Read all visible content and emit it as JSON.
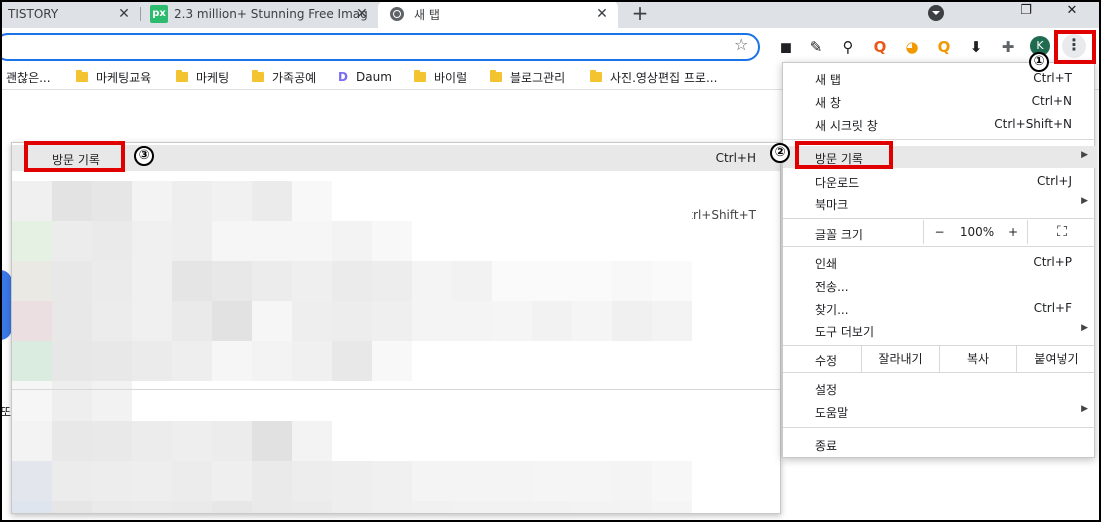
{
  "tabs": [
    {
      "title": "TISTORY",
      "close": "✕"
    },
    {
      "icon_text": "px",
      "title": "2.3 million+ Stunning Free Imag",
      "close": "✕"
    },
    {
      "title": "새 탭",
      "close": "✕"
    }
  ],
  "new_tab": "+",
  "window_controls": {
    "restore": "❐",
    "close": "✕"
  },
  "toolbar": {
    "star": "☆",
    "avatar": "K",
    "menu": "⋮"
  },
  "extensions": [
    {
      "name": "ext-glasses",
      "glyph": "◼",
      "color": "#202124"
    },
    {
      "name": "ext-pen",
      "glyph": "✎",
      "color": "#202124"
    },
    {
      "name": "ext-magnifier",
      "glyph": "⚲",
      "color": "#202124"
    },
    {
      "name": "ext-q1",
      "glyph": "Q",
      "color": "#e8591a"
    },
    {
      "name": "ext-q2",
      "glyph": "◕",
      "color": "#f29900"
    },
    {
      "name": "ext-q3",
      "glyph": "Q",
      "color": "#f29900"
    },
    {
      "name": "ext-download",
      "glyph": "⬇",
      "color": "#202124"
    },
    {
      "name": "ext-puzzle",
      "glyph": "✚",
      "color": "#5f6368"
    }
  ],
  "bookmarks": [
    {
      "label": "괜찮은...",
      "folder": false,
      "daum": false
    },
    {
      "label": "마케팅교육",
      "folder": true,
      "daum": false
    },
    {
      "label": "마케팅",
      "folder": true,
      "daum": false
    },
    {
      "label": "가족공예",
      "folder": true,
      "daum": false
    },
    {
      "label": "Daum",
      "folder": false,
      "daum": true
    },
    {
      "label": "바이럴",
      "folder": true,
      "daum": false
    },
    {
      "label": "블로그관리",
      "folder": true,
      "daum": false
    },
    {
      "label": "사진.영상편집 프로...",
      "folder": true,
      "daum": false
    }
  ],
  "history_submenu": {
    "title": "방문 기록",
    "shortcut": "Ctrl+H",
    "second_shortcut": "Ctrl+Shift+T"
  },
  "left_fragment": "또",
  "menu": {
    "items_top": [
      {
        "label": "새 탭",
        "shortcut": "Ctrl+T"
      },
      {
        "label": "새 창",
        "shortcut": "Ctrl+N"
      },
      {
        "label": "새 시크릿 창",
        "shortcut": "Ctrl+Shift+N"
      }
    ],
    "items_mid": [
      {
        "label": "방문 기록",
        "shortcut": "",
        "submenu": true
      },
      {
        "label": "다운로드",
        "shortcut": "Ctrl+J",
        "submenu": false
      },
      {
        "label": "북마크",
        "shortcut": "",
        "submenu": true
      }
    ],
    "zoom": {
      "label": "글꼴 크기",
      "minus": "−",
      "value": "100%",
      "plus": "+",
      "fullscreen": "⛶"
    },
    "items_tools": [
      {
        "label": "인쇄",
        "shortcut": "Ctrl+P",
        "submenu": false
      },
      {
        "label": "전송...",
        "shortcut": "",
        "submenu": false
      },
      {
        "label": "찾기...",
        "shortcut": "Ctrl+F",
        "submenu": false
      },
      {
        "label": "도구 더보기",
        "shortcut": "",
        "submenu": true
      }
    ],
    "edit": {
      "label": "수정",
      "cut": "잘라내기",
      "copy": "복사",
      "paste": "붙여넣기"
    },
    "items_settings": [
      {
        "label": "설정",
        "submenu": false
      },
      {
        "label": "도움말",
        "submenu": true
      }
    ],
    "exit": "종료",
    "submenu_arrow": "▶"
  },
  "annotations": [
    "①",
    "②",
    "③"
  ],
  "blur_rows": [
    [
      "#f0f0f0",
      "#e3e3e3",
      "#e6e6e6",
      "#f3f3f3",
      "#eeeeee",
      "#f1f1f1",
      "#ebebeb",
      "#f8f8f8",
      "#ffffff",
      "#ffffff",
      "#ffffff",
      "#ffffff",
      "#ffffff",
      "#ffffff",
      "#ffffff",
      "#ffffff",
      "#ffffff"
    ],
    [
      "#e5f2e3",
      "#ececec",
      "#eaeaea",
      "#f0f0f0",
      "#eeeeee",
      "#f6f6f6",
      "#f6f6f6",
      "#f6f6f6",
      "#f3f3f3",
      "#f8f8f8",
      "#ffffff",
      "#ffffff",
      "#ffffff",
      "#ffffff",
      "#ffffff",
      "#ffffff",
      "#ffffff"
    ],
    [
      "#ebe9e4",
      "#e8e8e8",
      "#ebebeb",
      "#f0f0f0",
      "#e5e5e5",
      "#e8e8e8",
      "#ececec",
      "#efefef",
      "#ebebeb",
      "#ededed",
      "#f4f4f4",
      "#f2f2f2",
      "#fafafa",
      "#fafafa",
      "#fafafa",
      "#f8f8f8",
      "#fafafa"
    ],
    [
      "#ecdfe2",
      "#e8e8e8",
      "#ececec",
      "#f0f0f0",
      "#eaeaea",
      "#e2e2e2",
      "#f6f6f6",
      "#eeeeee",
      "#ededed",
      "#efefef",
      "#f4f4f4",
      "#f4f4f4",
      "#f5f5f5",
      "#f2f2f2",
      "#f5f5f5",
      "#f0f0f0",
      "#f3f3f3"
    ],
    [
      "#d9ecdf",
      "#e7e7e7",
      "#e8e8e8",
      "#ebebeb",
      "#eeeeee",
      "#f6f6f6",
      "#f3f3f3",
      "#f0f0f0",
      "#e8e8e8",
      "#f8f8f8",
      "#ffffff",
      "#ffffff",
      "#ffffff",
      "#ffffff",
      "#ffffff",
      "#ffffff",
      "#ffffff"
    ],
    [
      "#f6f6f6",
      "#eeeeee",
      "#f2f2f2",
      "#ffffff",
      "#ffffff",
      "#ffffff",
      "#ffffff",
      "#ffffff",
      "#ffffff",
      "#ffffff",
      "#ffffff",
      "#ffffff",
      "#ffffff",
      "#ffffff",
      "#ffffff",
      "#ffffff",
      "#ffffff"
    ],
    [
      "#f3f3f3",
      "#e8e8e8",
      "#e9e9e9",
      "#ececec",
      "#eeeeee",
      "#ececec",
      "#e1e1e1",
      "#f3f3f3",
      "#ffffff",
      "#ffffff",
      "#ffffff",
      "#ffffff",
      "#ffffff",
      "#ffffff",
      "#ffffff",
      "#ffffff",
      "#ffffff"
    ],
    [
      "#e3e6ec",
      "#ececec",
      "#ededed",
      "#eeeeee",
      "#ececec",
      "#efefef",
      "#eaeaea",
      "#ededed",
      "#eeeeee",
      "#f0f0f0",
      "#f4f4f4",
      "#f4f4f4",
      "#f4f4f4",
      "#f5f5f5",
      "#f5f5f5",
      "#f4f4f4",
      "#f7f7f7"
    ],
    [
      "#dfe5ef",
      "#e6e6e6",
      "#eaeaea",
      "#ebebeb",
      "#eaeaea",
      "#e7e7e7",
      "#eaeaea",
      "#ebebeb",
      "#eeeeee",
      "#f0f0f0",
      "#f1f1f1",
      "#f2f2f2",
      "#f2f2f2",
      "#f2f2f2",
      "#f3f3f3",
      "#f3f3f3",
      "#f5f5f5"
    ]
  ]
}
